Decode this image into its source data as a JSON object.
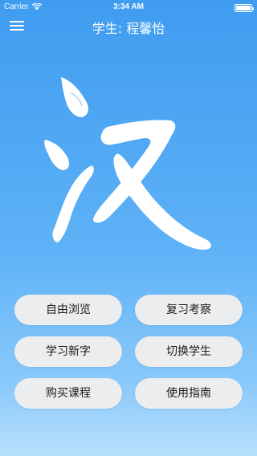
{
  "status_bar": {
    "carrier": "Carrier",
    "time": "3:34 AM"
  },
  "nav": {
    "title": "学生: 程馨怡",
    "menu_icon": "hamburger-menu-icon"
  },
  "logo": {
    "character": "汉"
  },
  "actions": [
    {
      "label": "自由浏览"
    },
    {
      "label": "复习考察"
    },
    {
      "label": "学习新字"
    },
    {
      "label": "切换学生"
    },
    {
      "label": "购买课程"
    },
    {
      "label": "使用指南"
    }
  ],
  "colors": {
    "background_top": "#3f9cf0",
    "background_bottom": "#b9e0fd",
    "button": "#ecedef"
  }
}
